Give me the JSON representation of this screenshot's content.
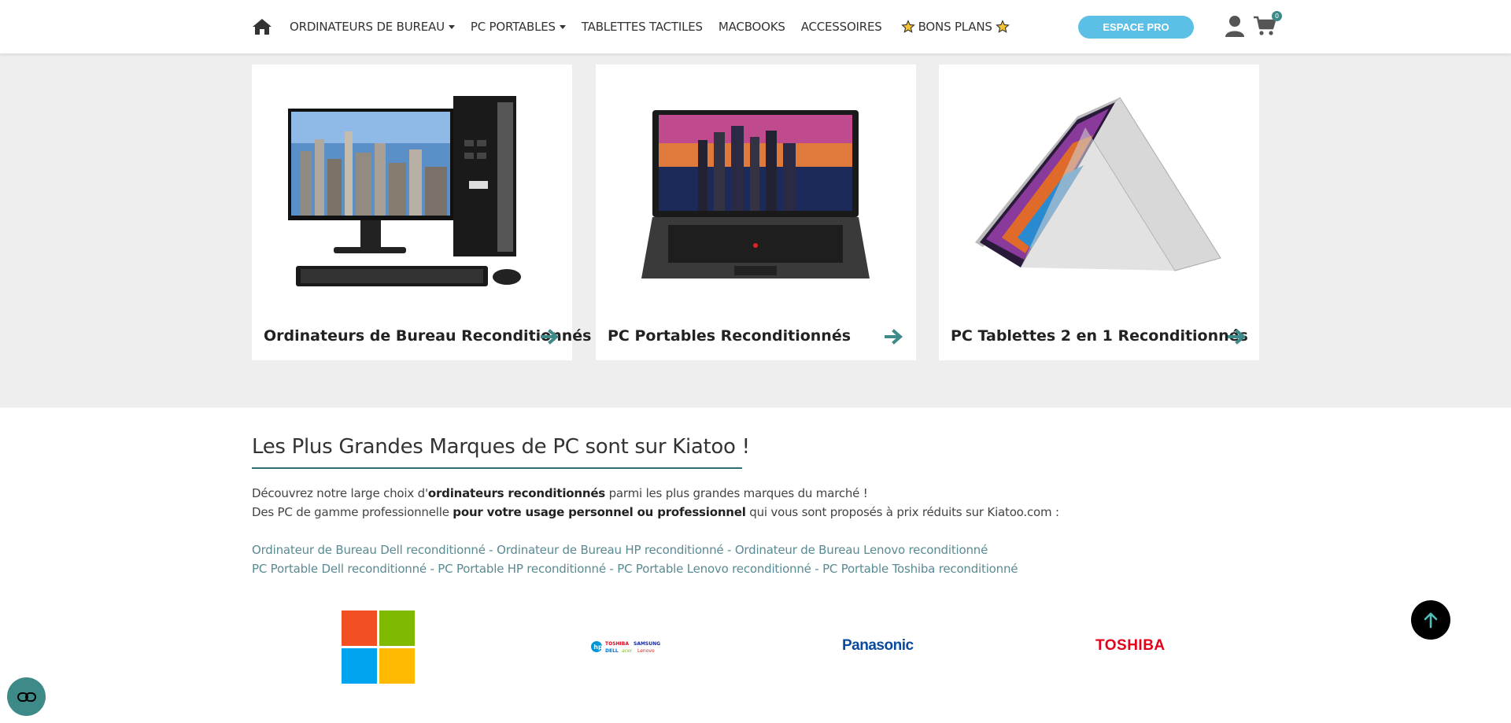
{
  "nav": {
    "items": [
      {
        "label": "ORDINATEURS DE BUREAU",
        "dropdown": true
      },
      {
        "label": "PC PORTABLES",
        "dropdown": true
      },
      {
        "label": "TABLETTES TACTILES",
        "dropdown": false
      },
      {
        "label": "MACBOOKS",
        "dropdown": false
      },
      {
        "label": "ACCESSOIRES",
        "dropdown": false
      }
    ],
    "deals_label": "BONS PLANS",
    "pro_button": "ESPACE PRO",
    "cart_count": "0"
  },
  "categories": [
    {
      "title": "Ordinateurs de Bureau Reconditionnés",
      "icon": "desktop-pc-image"
    },
    {
      "title": "PC Portables Reconditionnés",
      "icon": "laptop-image"
    },
    {
      "title": "PC Tablettes 2 en 1 Reconditionnés",
      "icon": "tablet-2in1-image"
    }
  ],
  "brands": {
    "heading": "Les Plus Grandes Marques de PC sont sur Kiatoo !",
    "intro_line1": {
      "before": "Découvrez notre large choix d'",
      "bold": "ordinateurs reconditionnés",
      "after": " parmi les plus grandes marques du marché !"
    },
    "intro_line2": {
      "before": "Des PC de gamme professionnelle ",
      "bold": "pour votre usage personnel ou professionnel",
      "after": " qui vous sont proposés à prix réduits sur Kiatoo.com :"
    },
    "links_row1": [
      "Ordinateur de Bureau Dell reconditionné",
      "Ordinateur de Bureau HP reconditionné",
      "Ordinateur de Bureau Lenovo reconditionné"
    ],
    "links_row2": [
      "PC Portable Dell reconditionné",
      "PC Portable HP reconditionné",
      "PC Portable Lenovo reconditionné",
      "PC Portable Toshiba reconditionné"
    ],
    "separator": " - ",
    "logos": {
      "multi": [
        "TOSHIBA",
        "SAMSUNG",
        "DELL",
        "acer",
        "Lenovo"
      ],
      "panasonic": "Panasonic",
      "toshiba": "TOSHIBA"
    }
  },
  "colors": {
    "accent": "#3d8a88",
    "pro_button": "#5bbfe6",
    "section_bg": "#eeeeee",
    "link": "#5a8a92",
    "toshiba_red": "#e2001a",
    "panasonic_blue": "#0a4a9e"
  }
}
